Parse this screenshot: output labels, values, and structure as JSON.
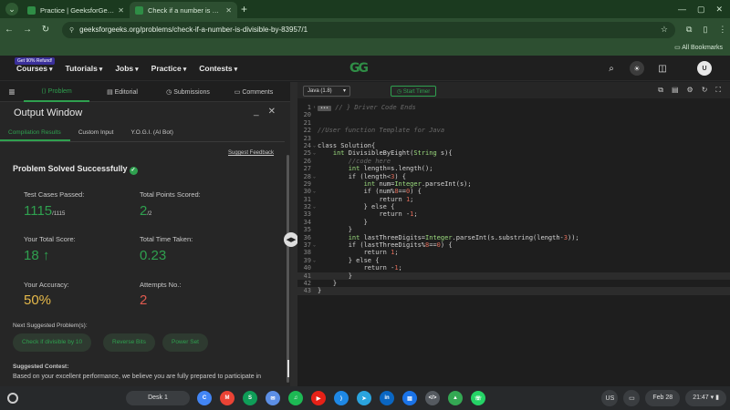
{
  "browser": {
    "tabs": [
      {
        "title": "Practice | GeeksforGeeks | A c",
        "active": false
      },
      {
        "title": "Check if a number is divisible b",
        "active": true
      }
    ],
    "url": "geeksforgeeks.org/problems/check-if-a-number-is-divisible-by-83957/1",
    "bookmarks_label": "All Bookmarks"
  },
  "header": {
    "badge": "Get 90% Refund!",
    "menu": [
      "Courses",
      "Tutorials",
      "Jobs",
      "Practice",
      "Contests"
    ],
    "logo": "GG",
    "avatar": "U"
  },
  "left_tabs": [
    "Problem",
    "Editorial",
    "Submissions",
    "Comments"
  ],
  "output_window": {
    "title": "Output Window",
    "tabs": [
      "Compilation Results",
      "Custom Input",
      "Y.O.G.I. (AI Bot)"
    ],
    "suggest_feedback": "Suggest Feedback",
    "status": "Problem Solved Successfully",
    "stats": {
      "test_cases_label": "Test Cases Passed:",
      "test_cases_value": "1115",
      "test_cases_total": "/1115",
      "points_label": "Total Points Scored:",
      "points_value": "2",
      "points_total": "/2",
      "score_label": "Your Total Score:",
      "score_value": "18",
      "time_label": "Total Time Taken:",
      "time_value": "0.23",
      "accuracy_label": "Your Accuracy:",
      "accuracy_value": "50%",
      "attempts_label": "Attempts No.:",
      "attempts_value": "2"
    },
    "next_label": "Next Suggested Problem(s):",
    "next_problems": [
      "Check if divisible by 10",
      "Reverse Bits",
      "Power Set"
    ],
    "contest_label": "Suggested Contest:",
    "contest_text": "Based on your excellent performance, we believe you are fully prepared to participate in"
  },
  "editor": {
    "language": "Java (1.8)",
    "timer": "Start Timer",
    "lines": [
      {
        "n": "1",
        "fold": "+",
        "html": "<span class='fold-badge'>•••</span><span class='cm'> // } Driver Code Ends</span>"
      },
      {
        "n": "20",
        "html": ""
      },
      {
        "n": "21",
        "html": ""
      },
      {
        "n": "22",
        "html": "<span class='cm'>//User function Template for Java</span>"
      },
      {
        "n": "23",
        "html": ""
      },
      {
        "n": "24",
        "fold": "v",
        "html": "<span class='kw'>class</span> Solution{"
      },
      {
        "n": "25",
        "fold": "v",
        "html": "    <span class='ty'>int</span> DivisibleByEight(<span class='ty'>String</span> s){"
      },
      {
        "n": "26",
        "html": "        <span class='cm'>//code here</span>"
      },
      {
        "n": "27",
        "html": "        <span class='ty'>int</span> length=s.length();"
      },
      {
        "n": "28",
        "fold": "v",
        "html": "        <span class='kw'>if</span> (length<<span class='nm'>3</span>) {"
      },
      {
        "n": "29",
        "html": "            <span class='ty'>int</span> num=<span class='ty'>Integer</span>.parseInt(s);"
      },
      {
        "n": "30",
        "fold": "v",
        "html": "            <span class='kw'>if</span> (num%<span class='nm'>8</span>==<span class='nm'>0</span>) {"
      },
      {
        "n": "31",
        "html": "                <span class='kw'>return</span> <span class='nm'>1</span>;"
      },
      {
        "n": "32",
        "fold": "v",
        "html": "            } <span class='kw'>else</span> {"
      },
      {
        "n": "33",
        "html": "                <span class='kw'>return</span> -<span class='nm'>1</span>;"
      },
      {
        "n": "34",
        "html": "            }"
      },
      {
        "n": "35",
        "html": "        }"
      },
      {
        "n": "36",
        "html": "        <span class='ty'>int</span> lastThreeDigits=<span class='ty'>Integer</span>.parseInt(s.substring(length-<span class='nm'>3</span>));"
      },
      {
        "n": "37",
        "fold": "v",
        "html": "        <span class='kw'>if</span> (lastThreeDigits%<span class='nm'>8</span>==<span class='nm'>0</span>) {"
      },
      {
        "n": "38",
        "html": "            <span class='kw'>return</span> <span class='nm'>1</span>;"
      },
      {
        "n": "39",
        "fold": "v",
        "html": "        } <span class='kw'>else</span> {"
      },
      {
        "n": "40",
        "html": "            <span class='kw'>return</span> -<span class='nm'>1</span>;"
      },
      {
        "n": "41",
        "html": "        }",
        "hl": true
      },
      {
        "n": "42",
        "html": "    }"
      },
      {
        "n": "43",
        "html": "}",
        "hl": true
      }
    ]
  },
  "shelf": {
    "desk": "Desk 1",
    "apps": [
      {
        "name": "chrome",
        "label": "C",
        "color": "#4285f4"
      },
      {
        "name": "gmail",
        "label": "M",
        "color": "#ea4335"
      },
      {
        "name": "sheets",
        "label": "S",
        "color": "#0f9d58"
      },
      {
        "name": "gmail-alt",
        "label": "✉",
        "color": "#5c8fe6"
      },
      {
        "name": "spotify",
        "label": "♫",
        "color": "#1db954"
      },
      {
        "name": "youtube",
        "label": "▶",
        "color": "#e62117"
      },
      {
        "name": "vscode",
        "label": "⟩",
        "color": "#1e88e5"
      },
      {
        "name": "telegram",
        "label": "➤",
        "color": "#2aa4de"
      },
      {
        "name": "linkedin",
        "label": "in",
        "color": "#0a66c2"
      },
      {
        "name": "files",
        "label": "▤",
        "color": "#1a73e8"
      },
      {
        "name": "code-app",
        "label": "</>",
        "color": "#555a60"
      },
      {
        "name": "drive",
        "label": "▲",
        "color": "#34a853"
      },
      {
        "name": "whatsapp",
        "label": "☏",
        "color": "#25d366"
      }
    ],
    "locale": "US",
    "date": "Feb 28",
    "time": "21:47"
  }
}
